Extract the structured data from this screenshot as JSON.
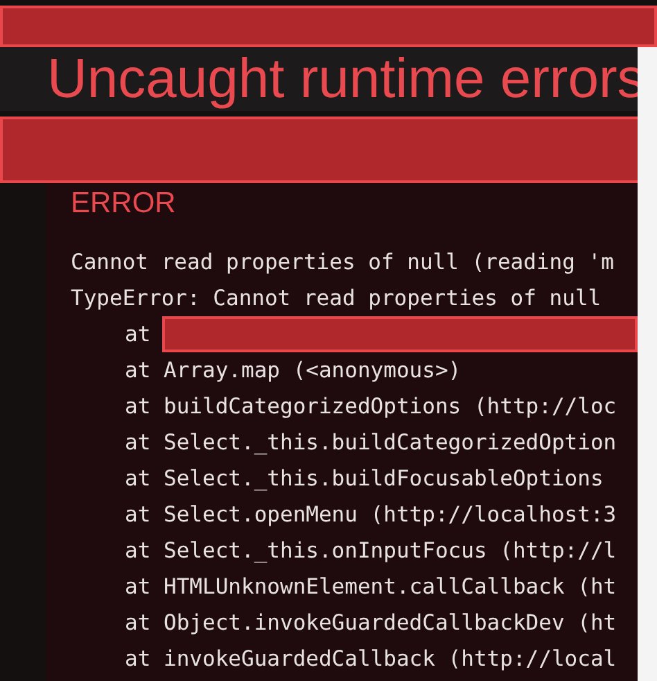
{
  "title": "Uncaught runtime errors",
  "error_label": "ERROR",
  "message_lines": [
    "Cannot read properties of null (reading 'm",
    "TypeError: Cannot read properties of null"
  ],
  "stack_lines": [
    {
      "text": "at",
      "redacted": true
    },
    {
      "text": "at Array.map (<anonymous>)",
      "redacted": false
    },
    {
      "text": "at buildCategorizedOptions (http://loc",
      "redacted": false
    },
    {
      "text": "at Select._this.buildCategorizedOption",
      "redacted": false
    },
    {
      "text": "at Select._this.buildFocusableOptions",
      "redacted": false
    },
    {
      "text": "at Select.openMenu (http://localhost:3",
      "redacted": false
    },
    {
      "text": "at Select._this.onInputFocus (http://l",
      "redacted": false
    },
    {
      "text": "at HTMLUnknownElement.callCallback (ht",
      "redacted": false
    },
    {
      "text": "at Object.invokeGuardedCallbackDev (ht",
      "redacted": false
    },
    {
      "text": "at invokeGuardedCallback (http://local",
      "redacted": false
    }
  ]
}
